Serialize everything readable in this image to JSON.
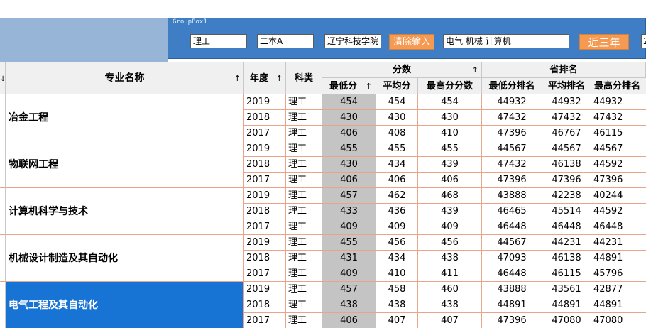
{
  "groupbox": {
    "title": "GroupBox1",
    "field_kelei": "理工",
    "field_pici": "二本A",
    "field_school": "辽宁科技学院",
    "clear_label": "清除输入",
    "field_majors": "电气 机械 计算机",
    "recent_label": "近三年",
    "field_extra": "2"
  },
  "header": {
    "left_arrow": "↓",
    "major": "专业名称",
    "major_sort": "↑",
    "year": "年度",
    "year_sort": "↑",
    "kelei": "科类",
    "score_group": "分数",
    "score_group_sort": "↑",
    "rank_group": "省排名",
    "min": "最低分",
    "min_sort": "↑",
    "avg": "平均分",
    "max": "最高分分数",
    "min_rank": "最低分排名",
    "avg_rank": "平均排名",
    "max_rank": "最高分排名"
  },
  "majors": [
    {
      "name": "冶金工程",
      "rows": [
        {
          "year": "2019",
          "kelei": "理工",
          "min": "454",
          "avg": "454",
          "max": "454",
          "min_rank": "44932",
          "avg_rank": "44932",
          "max_rank": "44932"
        },
        {
          "year": "2018",
          "kelei": "理工",
          "min": "430",
          "avg": "430",
          "max": "430",
          "min_rank": "47432",
          "avg_rank": "47432",
          "max_rank": "47432"
        },
        {
          "year": "2017",
          "kelei": "理工",
          "min": "406",
          "avg": "408",
          "max": "410",
          "min_rank": "47396",
          "avg_rank": "46767",
          "max_rank": "46115"
        }
      ]
    },
    {
      "name": "物联网工程",
      "rows": [
        {
          "year": "2019",
          "kelei": "理工",
          "min": "455",
          "avg": "455",
          "max": "455",
          "min_rank": "44567",
          "avg_rank": "44567",
          "max_rank": "44567"
        },
        {
          "year": "2018",
          "kelei": "理工",
          "min": "430",
          "avg": "434",
          "max": "439",
          "min_rank": "47432",
          "avg_rank": "46138",
          "max_rank": "44592"
        },
        {
          "year": "2017",
          "kelei": "理工",
          "min": "406",
          "avg": "406",
          "max": "406",
          "min_rank": "47396",
          "avg_rank": "47396",
          "max_rank": "47396"
        }
      ]
    },
    {
      "name": "计算机科学与技术",
      "rows": [
        {
          "year": "2019",
          "kelei": "理工",
          "min": "457",
          "avg": "462",
          "max": "468",
          "min_rank": "43888",
          "avg_rank": "42238",
          "max_rank": "40244"
        },
        {
          "year": "2018",
          "kelei": "理工",
          "min": "433",
          "avg": "436",
          "max": "439",
          "min_rank": "46465",
          "avg_rank": "45514",
          "max_rank": "44592"
        },
        {
          "year": "2017",
          "kelei": "理工",
          "min": "409",
          "avg": "409",
          "max": "409",
          "min_rank": "46448",
          "avg_rank": "46448",
          "max_rank": "46448"
        }
      ]
    },
    {
      "name": "机械设计制造及其自动化",
      "rows": [
        {
          "year": "2019",
          "kelei": "理工",
          "min": "455",
          "avg": "456",
          "max": "456",
          "min_rank": "44567",
          "avg_rank": "44231",
          "max_rank": "44231"
        },
        {
          "year": "2018",
          "kelei": "理工",
          "min": "431",
          "avg": "434",
          "max": "438",
          "min_rank": "47093",
          "avg_rank": "46138",
          "max_rank": "44891"
        },
        {
          "year": "2017",
          "kelei": "理工",
          "min": "409",
          "avg": "410",
          "max": "411",
          "min_rank": "46448",
          "avg_rank": "46115",
          "max_rank": "45796"
        }
      ]
    },
    {
      "name": "电气工程及其自动化",
      "selected": true,
      "rows": [
        {
          "year": "2019",
          "kelei": "理工",
          "min": "457",
          "avg": "458",
          "max": "460",
          "min_rank": "43888",
          "avg_rank": "43561",
          "max_rank": "42877"
        },
        {
          "year": "2018",
          "kelei": "理工",
          "min": "438",
          "avg": "438",
          "max": "438",
          "min_rank": "44891",
          "avg_rank": "44891",
          "max_rank": "44891"
        },
        {
          "year": "2017",
          "kelei": "理工",
          "min": "406",
          "avg": "407",
          "max": "407",
          "min_rank": "47396",
          "avg_rank": "47080",
          "max_rank": "47080"
        }
      ]
    }
  ]
}
